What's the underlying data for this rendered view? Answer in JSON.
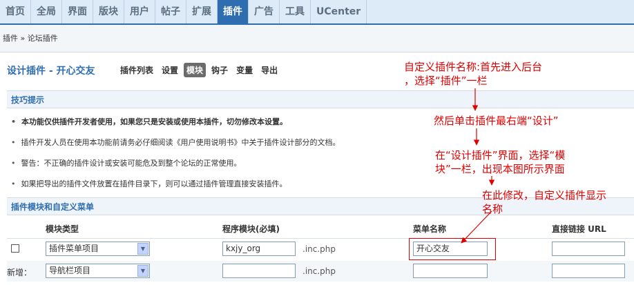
{
  "nav": {
    "tabs": [
      "首页",
      "全局",
      "界面",
      "版块",
      "用户",
      "帖子",
      "扩展",
      "插件",
      "广告",
      "工具",
      "UCenter"
    ],
    "active": "插件"
  },
  "breadcrumb": "插件 » 论坛插件",
  "page": {
    "title": "设计插件 - 开心交友",
    "subnav": [
      "插件列表",
      "设置",
      "模块",
      "钩子",
      "变量",
      "导出"
    ],
    "subnav_active": "模块"
  },
  "tips": {
    "header": "技巧提示",
    "items": [
      "本功能仅供插件开发者使用，如果您只是安装或使用本插件，切勿修改本设置。",
      "插件开发人员在使用本功能前请务必仔细阅读《用户使用说明书》中关于插件设计部分的文档。",
      "警告：不正确的插件设计或安装可能危及到整个论坛的正常使用。",
      "如果把导出的插件文件放置在插件目录下，则可以通过插件管理直接安装插件。"
    ]
  },
  "modules": {
    "header": "插件模块和自定义菜单",
    "columns": [
      "模块类型",
      "程序模块(必填)",
      "菜单名称",
      "直接链接 URL"
    ],
    "rows": [
      {
        "label": "",
        "type": "插件菜单项目",
        "module": "kxjy_org",
        "ext": ".inc.php",
        "menu": "开心交友",
        "url": ""
      },
      {
        "label": "新增：",
        "type": "导航栏项目",
        "module": "",
        "ext": ".inc.php",
        "menu": "",
        "url": ""
      }
    ]
  },
  "annotations": {
    "a1_line1": "自定义插件名称:首先进入后台",
    "a1_line2": "，选择“插件”一栏",
    "a2": "然后单击插件最右端“设计”",
    "a3_line1": "在“设计插件”界面，选择“模",
    "a3_line2": "块”一栏，出现本图所示界面",
    "a4_line1": "在此修改，自定义插件显示",
    "a4_line2": "名称"
  },
  "colors": {
    "accent": "#2e6eb0",
    "annotation": "#e00000"
  }
}
